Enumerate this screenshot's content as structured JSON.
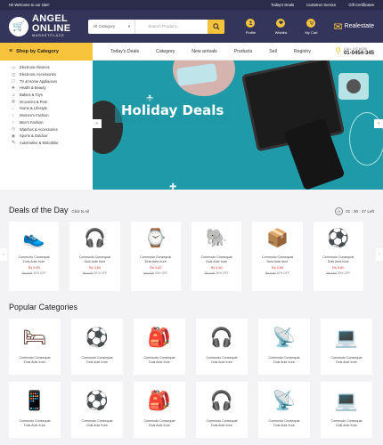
{
  "topbar": {
    "welcome": "Hi! Welcome to our site!!",
    "links": [
      "Today's Deals",
      "Customer Service",
      "Gift Certificates"
    ]
  },
  "header": {
    "logo_line1": "ANGEL",
    "logo_line2": "ONLINE",
    "logo_line3": "MARKETPLACE",
    "category_select": "All Category",
    "search_placeholder": "Search Product...",
    "icons": [
      {
        "label": "Profile",
        "icon": "user-icon"
      },
      {
        "label": "Wishlist",
        "icon": "heart-icon"
      },
      {
        "label": "My Cart",
        "icon": "cart-icon"
      }
    ],
    "realestate": "Realestate"
  },
  "nav": {
    "shop_by_category": "Shop by Category",
    "links": [
      "Today's Deals",
      "Category",
      "New arrivals",
      "Products",
      "Sell",
      "Registry"
    ],
    "call_label": "CALL US NOW",
    "phone": "01-0454-345"
  },
  "sidebar": {
    "items": [
      "Electronic Devices",
      "Electronic Accessories",
      "TV & Home Appliances",
      "Health & Beauty",
      "Babies & Toys",
      "Groceries & Pets",
      "Home & Lifestyle",
      "Women's Fashion",
      "Men's Fashion",
      "Watches & Accessories",
      "Sports & Outdoor",
      "Automotive & Motorbike"
    ]
  },
  "banner": {
    "title": "Holiday Deals"
  },
  "deals": {
    "title": "Deals of the Day",
    "subtitle": "Click to All",
    "timer": "01 : 30 : 47 Left",
    "items": [
      {
        "name1": "Commodo Consequat",
        "name2": "Duis Aute Irure",
        "price": "Rs 3.60",
        "old": "Rs 4.60",
        "off": "30% OFF",
        "icon": "shoe-icon",
        "glyph": "👟"
      },
      {
        "name1": "Commodo Consequat",
        "name2": "Duis Aute Irure",
        "price": "Rs 3.60",
        "old": "Rs 4.60",
        "off": "30% OFF",
        "icon": "headphones-icon",
        "glyph": "🎧"
      },
      {
        "name1": "Commodo Consequat",
        "name2": "Duis Aute Irure",
        "price": "Rs 3.60",
        "old": "Rs 4.60",
        "off": "30% OFF",
        "icon": "smartwatch-icon",
        "glyph": "⌚"
      },
      {
        "name1": "Commodo Consequat",
        "name2": "Duis Aute Irure",
        "price": "Rs 3.60",
        "old": "Rs 4.60",
        "off": "30% OFF",
        "icon": "toy-elephant-icon",
        "glyph": "🐘"
      },
      {
        "name1": "Commodo Consequat",
        "name2": "Duis Aute Irure",
        "price": "Rs 3.60",
        "old": "Rs 4.60",
        "off": "30% OFF",
        "icon": "product-box-icon",
        "glyph": "📦"
      },
      {
        "name1": "Commodo Consequat",
        "name2": "Duis Aute Irure",
        "price": "Rs 3.60",
        "old": "Rs 4.60",
        "off": "30% OFF",
        "icon": "football-icon",
        "glyph": "⚽"
      }
    ]
  },
  "popular": {
    "title": "Popular Categories",
    "row1": [
      {
        "name1": "Commodo Consequat",
        "name2": "Duis Aute Irure",
        "icon": "bunk-bed-icon",
        "glyph": "🛏"
      },
      {
        "name1": "Commodo Consequat",
        "name2": "Duis Aute Irure",
        "icon": "football-icon",
        "glyph": "⚽"
      },
      {
        "name1": "Commodo Consequat",
        "name2": "Duis Aute Irure",
        "icon": "backpack-icon",
        "glyph": "🎒"
      },
      {
        "name1": "Commodo Consequat",
        "name2": "Duis Aute Irure",
        "icon": "headphones-icon",
        "glyph": "🎧"
      },
      {
        "name1": "Commodo Consequat",
        "name2": "Duis Aute Irure",
        "icon": "router-box-icon",
        "glyph": "📡"
      },
      {
        "name1": "Commodo Consequat",
        "name2": "Duis Aute Irure",
        "icon": "laptop-icon",
        "glyph": "💻"
      }
    ],
    "row2": [
      {
        "name1": "Commodo Consequat",
        "name2": "Duis Aute Irure",
        "icon": "smartphone-icon",
        "glyph": "📱"
      },
      {
        "name1": "Commodo Consequat",
        "name2": "Duis Aute Irure",
        "icon": "football-icon",
        "glyph": "⚽"
      },
      {
        "name1": "Commodo Consequat",
        "name2": "Duis Aute Irure",
        "icon": "backpack-icon",
        "glyph": "🎒"
      },
      {
        "name1": "Commodo Consequat",
        "name2": "Duis Aute Irure",
        "icon": "headphones-icon",
        "glyph": "🎧"
      },
      {
        "name1": "Commodo Consequat",
        "name2": "Duis Aute Irure",
        "icon": "router-box-icon",
        "glyph": "📡"
      },
      {
        "name1": "Commodo Consequat",
        "name2": "Duis Aute Irure",
        "icon": "laptop-icon",
        "glyph": "💻"
      }
    ]
  }
}
